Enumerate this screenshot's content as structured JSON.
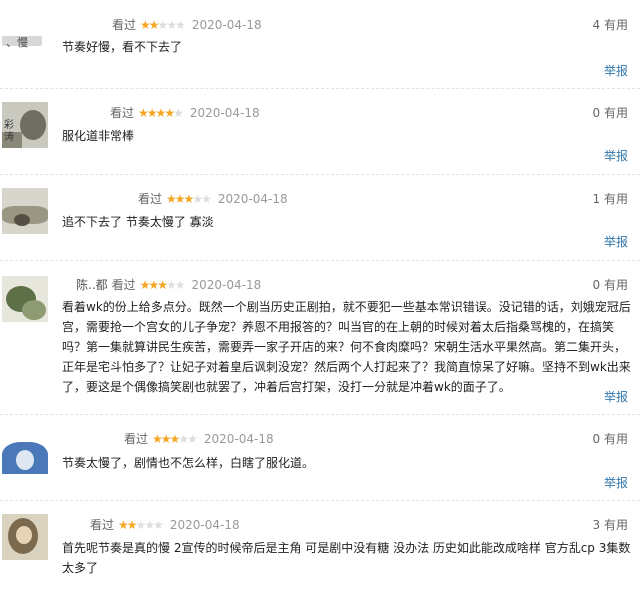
{
  "colors": {
    "link": "#3377aa",
    "star": "#f5a623",
    "star_off": "#dddddd",
    "divider": "#e3e3e3"
  },
  "reviews": [
    {
      "username": "",
      "status": "看过",
      "rating": 2,
      "date": "2020-04-18",
      "useful": "4 有用",
      "content": "节奏好慢，看不下去了",
      "report": "举报",
      "avatar_text": "、慢"
    },
    {
      "username": "",
      "status": "看过",
      "rating": 4,
      "date": "2020-04-18",
      "useful": "0 有用",
      "content": "服化道非常棒",
      "report": "举报",
      "avatar_text": "彩 涛"
    },
    {
      "username": "",
      "status": "看过",
      "rating": 3,
      "date": "2020-04-18",
      "useful": "1 有用",
      "content": "追不下去了 节奏太慢了 寡淡",
      "report": "举报",
      "avatar_text": ""
    },
    {
      "username": "陈..都",
      "status": "看过",
      "rating": 3,
      "date": "2020-04-18",
      "useful": "0 有用",
      "content": "看着wk的份上给多点分。既然一个剧当历史正剧拍，就不要犯一些基本常识错误。没记错的话，刘娥宠冠后宫，需要抢一个宫女的儿子争宠？养恩不用报答的？叫当官的在上朝的时候对着太后指桑骂槐的，在搞笑吗？第一集就算讲民生疾苦，需要弄一家子开店的来？何不食肉糜吗？宋朝生活水平果然高。第二集开头，正年是宅斗怕多了？让妃子对着皇后讽刺没宠？然后两个人打起来了？我简直惊呆了好嘛。坚持不到wk出来了，要这是个偶像搞笑剧也就罢了，冲着后宫打架，没打一分就是冲着wk的面子了。",
      "report": "举报",
      "avatar_text": ""
    },
    {
      "username": "",
      "status": "看过",
      "rating": 3,
      "date": "2020-04-18",
      "useful": "0 有用",
      "content": "节奏太慢了，剧情也不怎么样，白瞎了服化道。",
      "report": "举报",
      "avatar_text": ""
    },
    {
      "username": "",
      "status": "看过",
      "rating": 2,
      "date": "2020-04-18",
      "useful": "3 有用",
      "content": "首先呢节奏是真的慢 2宣传的时候帝后是主角 可是剧中没有糖 没办法 历史如此能改成啥样 官方乱cp 3集数太多了",
      "report": "举报",
      "avatar_text": ""
    }
  ]
}
